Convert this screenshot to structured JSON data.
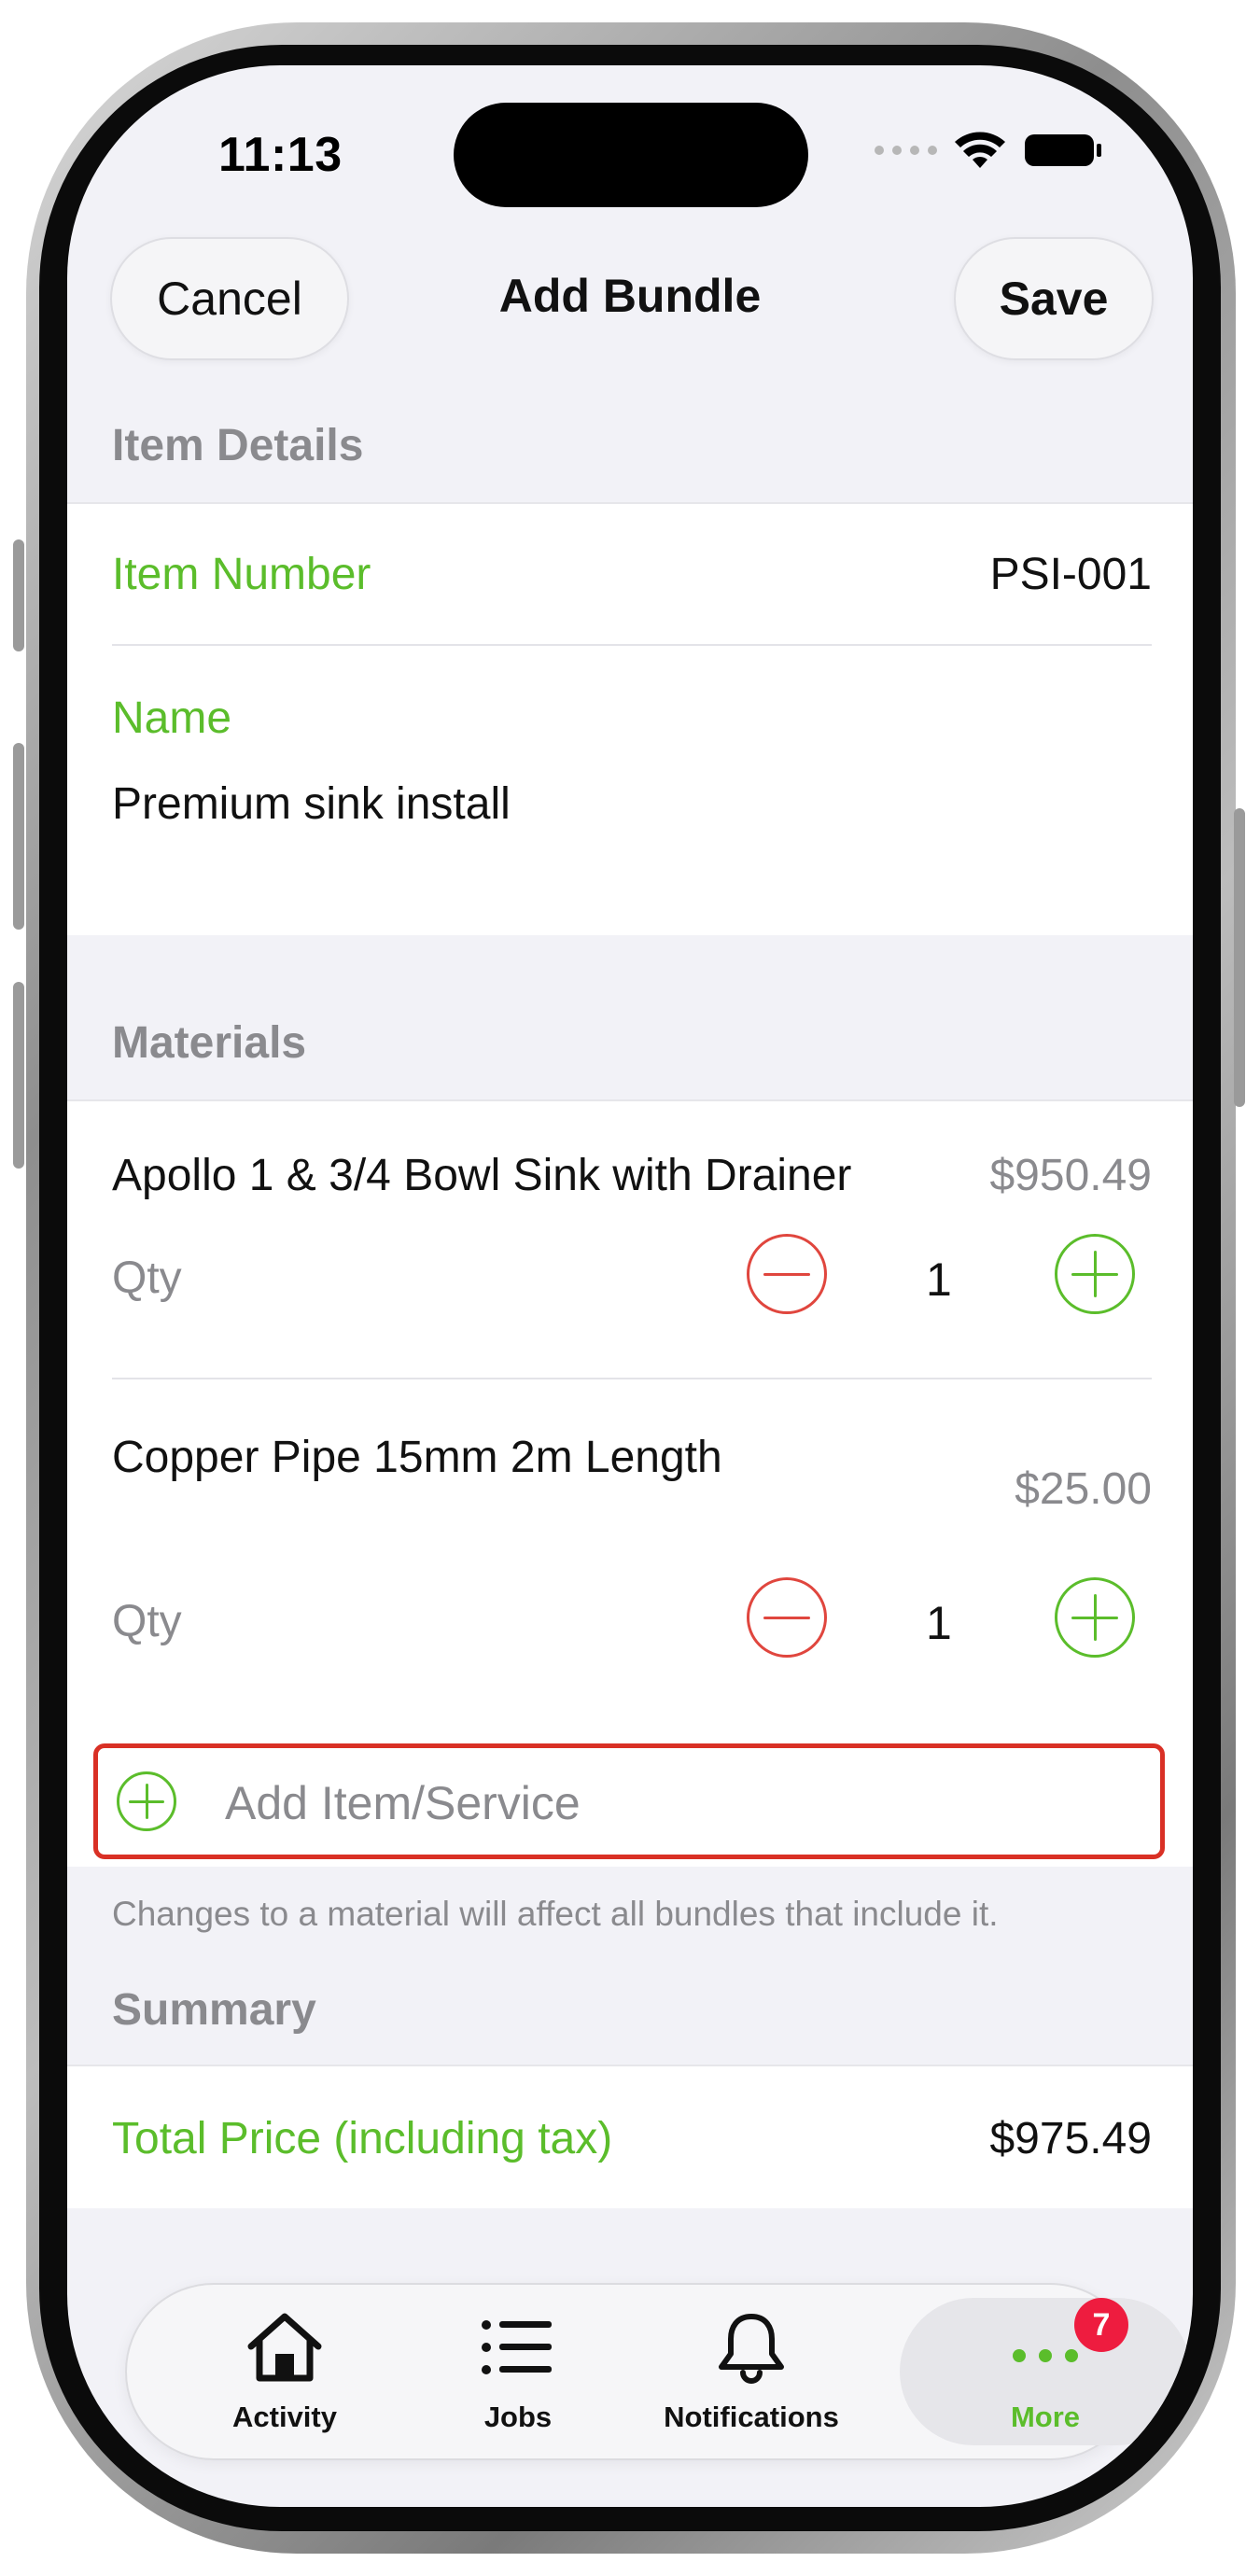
{
  "status_bar": {
    "time": "11:13"
  },
  "nav": {
    "cancel_label": "Cancel",
    "title": "Add Bundle",
    "save_label": "Save"
  },
  "item_details": {
    "header": "Item Details",
    "item_number_label": "Item Number",
    "item_number_value": "PSI-001",
    "name_label": "Name",
    "name_value": "Premium sink install"
  },
  "materials": {
    "header": "Materials",
    "qty_label": "Qty",
    "items": [
      {
        "name": "Apollo 1 & 3/4 Bowl Sink with Drainer",
        "price": "$950.49",
        "qty": "1"
      },
      {
        "name": "Copper Pipe 15mm 2m Length",
        "price": "$25.00",
        "qty": "1"
      }
    ],
    "add_label": "Add Item/Service",
    "footnote": "Changes to a material will affect all bundles that include it."
  },
  "summary": {
    "header": "Summary",
    "total_label": "Total Price (including tax)",
    "total_value": "$975.49"
  },
  "tab_bar": {
    "tabs": [
      {
        "label": "Activity",
        "icon": "house-icon"
      },
      {
        "label": "Jobs",
        "icon": "list-icon"
      },
      {
        "label": "Notifications",
        "icon": "bell-icon"
      },
      {
        "label": "More",
        "icon": "ellipsis-icon",
        "badge": "7",
        "selected": true
      }
    ]
  },
  "colors": {
    "accent_green": "#5bbd2b",
    "destructive_red": "#e0463e",
    "badge_red": "#ee1c3f",
    "highlight_border": "#d93025"
  }
}
